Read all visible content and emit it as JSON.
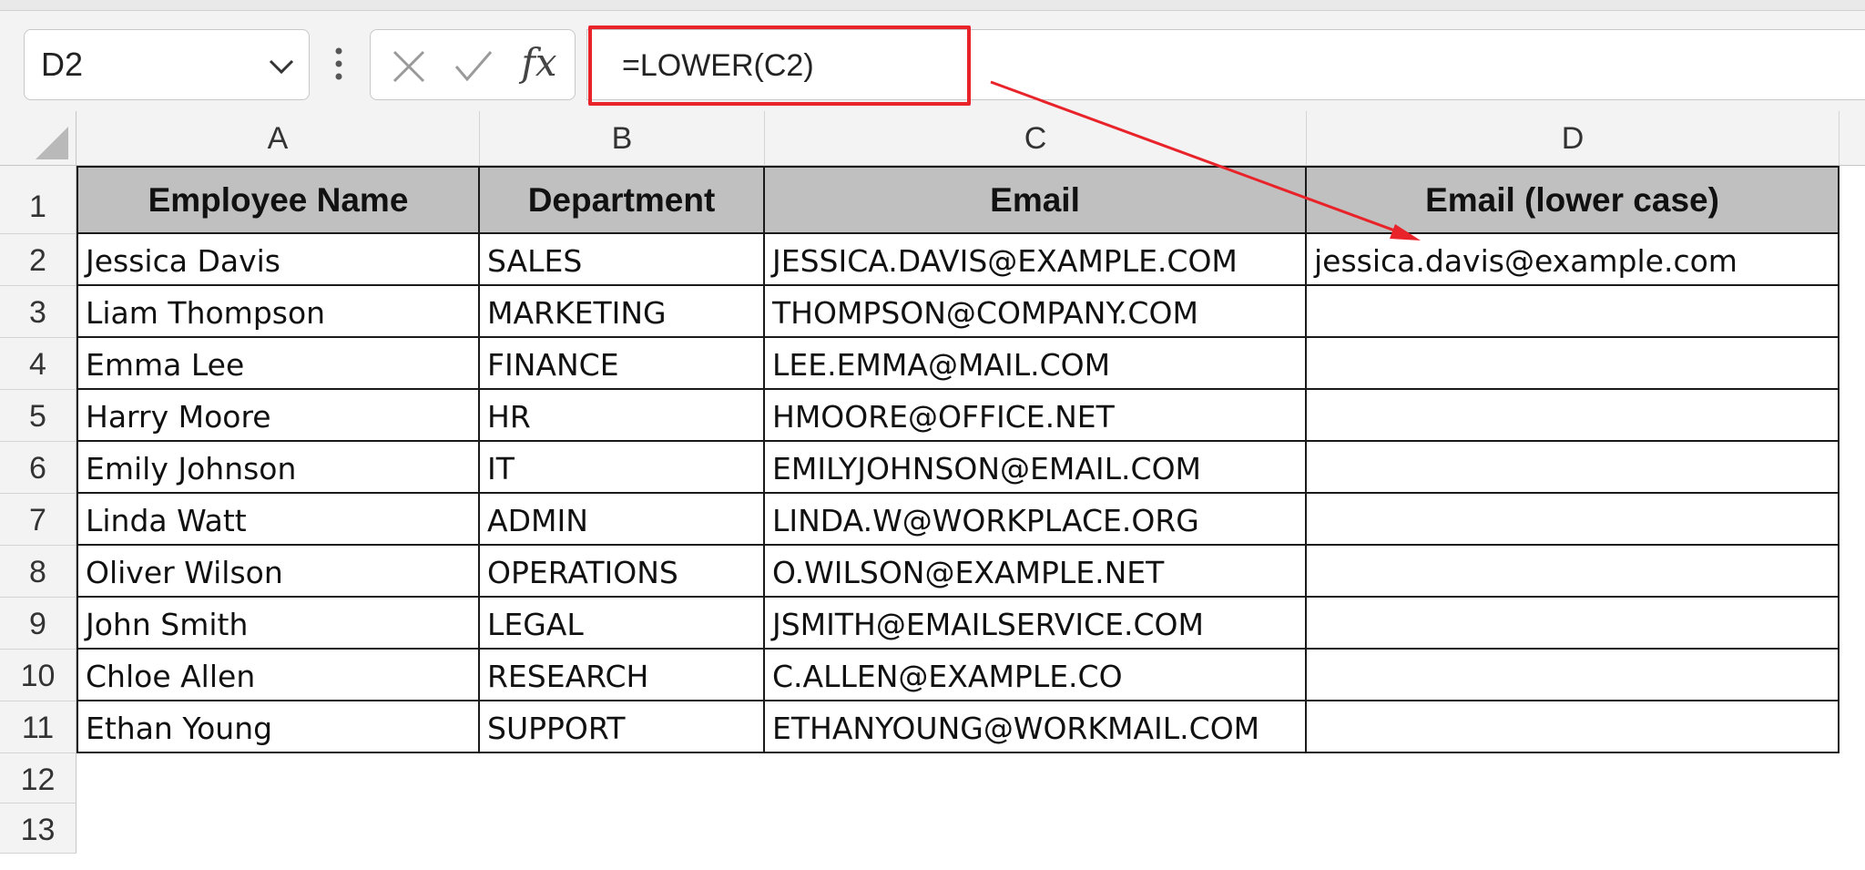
{
  "formula_bar": {
    "name_box": "D2",
    "formula": "=LOWER(C2)"
  },
  "icons": {
    "chevron": "chevron-down-icon",
    "more": "vertical-dots-icon",
    "cancel": "cancel-x-icon",
    "enter": "check-icon",
    "fx": "fx-icon",
    "fx_glyph": "fx"
  },
  "colors": {
    "highlight": "#e8232a",
    "header_fill": "#c0c0c0"
  },
  "columns": [
    "A",
    "B",
    "C",
    "D"
  ],
  "row_numbers": [
    "1",
    "2",
    "3",
    "4",
    "5",
    "6",
    "7",
    "8",
    "9",
    "10",
    "11",
    "12",
    "13"
  ],
  "table": {
    "headers": [
      "Employee  Name",
      "Department",
      "Email",
      "Email (lower case)"
    ],
    "rows": [
      [
        "Jessica Davis",
        "SALES",
        "JESSICA.DAVIS@EXAMPLE.COM",
        "jessica.davis@example.com"
      ],
      [
        "Liam Thompson",
        "MARKETING",
        "THOMPSON@COMPANY.COM",
        ""
      ],
      [
        "Emma Lee",
        "FINANCE",
        "LEE.EMMA@MAIL.COM",
        ""
      ],
      [
        "Harry Moore",
        "HR",
        "HMOORE@OFFICE.NET",
        ""
      ],
      [
        "Emily Johnson",
        "IT",
        "EMILYJOHNSON@EMAIL.COM",
        ""
      ],
      [
        "Linda Watt",
        "ADMIN",
        "LINDA.W@WORKPLACE.ORG",
        ""
      ],
      [
        "Oliver Wilson",
        "OPERATIONS",
        "O.WILSON@EXAMPLE.NET",
        ""
      ],
      [
        "John Smith",
        "LEGAL",
        "JSMITH@EMAILSERVICE.COM",
        ""
      ],
      [
        "Chloe Allen",
        "RESEARCH",
        "C.ALLEN@EXAMPLE.CO",
        ""
      ],
      [
        "Ethan Young",
        "SUPPORT",
        "ETHANYOUNG@WORKMAIL.COM",
        ""
      ]
    ]
  }
}
